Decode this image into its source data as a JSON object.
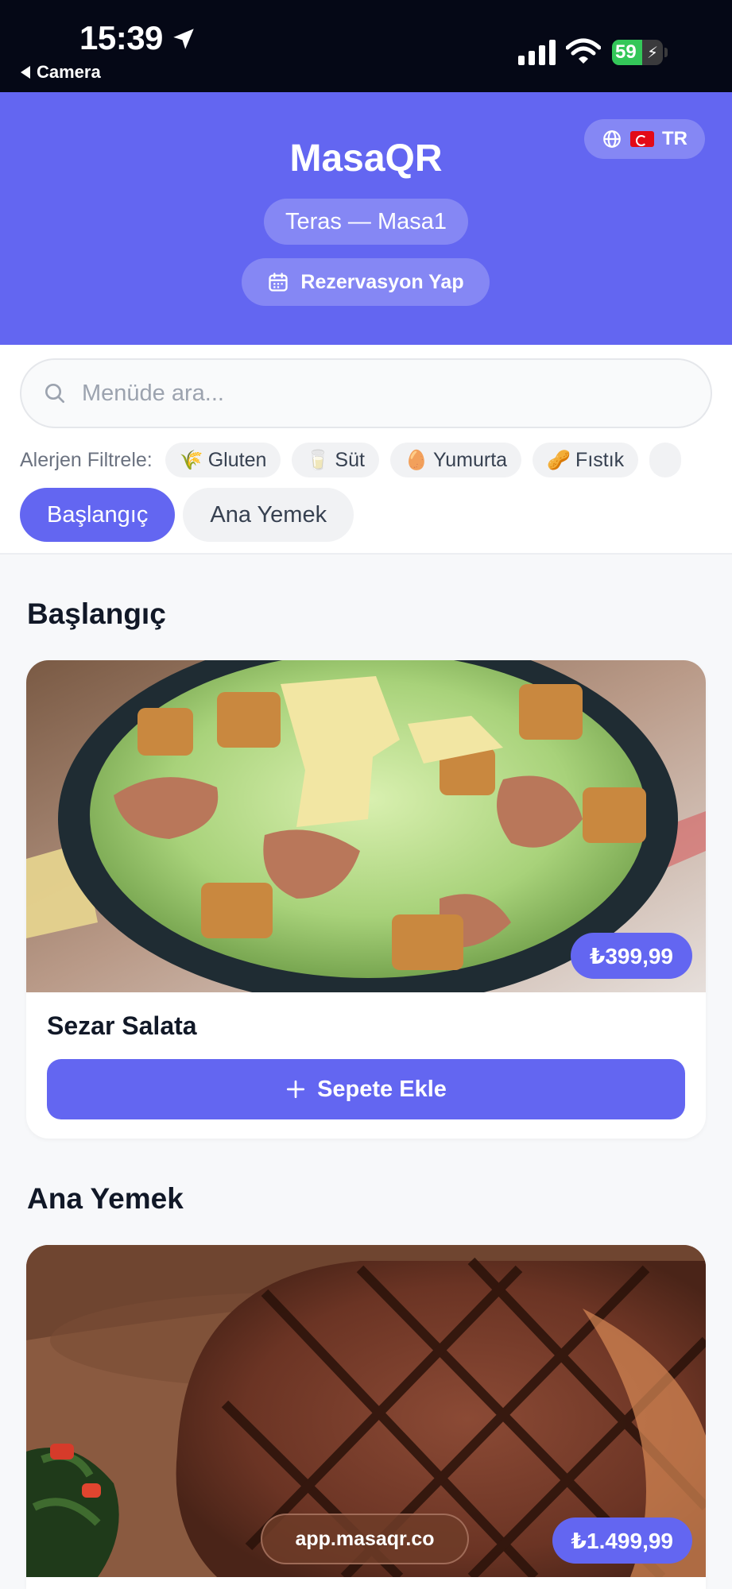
{
  "status_bar": {
    "time": "15:39",
    "back_label": "Camera",
    "battery_level": "59",
    "battery_percent": 59,
    "icons": [
      "location-arrow-icon",
      "cellular-signal-icon",
      "wifi-icon",
      "battery-charging-icon"
    ]
  },
  "header": {
    "brand": "MasaQR",
    "language_code": "TR",
    "table_label": "Teras — Masa1",
    "reservation_label": "Rezervasyon Yap",
    "accent_color": "#6366f1"
  },
  "search": {
    "placeholder": "Menüde ara..."
  },
  "allergens": {
    "label": "Alerjen Filtrele:",
    "items": [
      {
        "emoji": "🌾",
        "label": "Gluten"
      },
      {
        "emoji": "🥛",
        "label": "Süt"
      },
      {
        "emoji": "🥚",
        "label": "Yumurta"
      },
      {
        "emoji": "🥜",
        "label": "Fıstık"
      }
    ]
  },
  "categories": [
    {
      "label": "Başlangıç",
      "active": true
    },
    {
      "label": "Ana Yemek",
      "active": false
    }
  ],
  "sections": [
    {
      "title": "Başlangıç",
      "items": [
        {
          "name": "Sezar Salata",
          "price": "₺399,99",
          "add_label": "Sepete Ekle"
        }
      ]
    },
    {
      "title": "Ana Yemek",
      "items": [
        {
          "name": "",
          "price": "₺1.499,99"
        }
      ]
    }
  ],
  "browser": {
    "url": "app.masaqr.co"
  }
}
